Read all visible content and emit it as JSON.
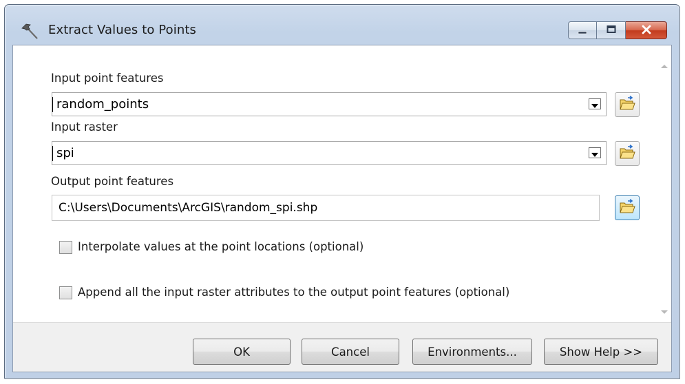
{
  "window": {
    "title": "Extract Values to Points",
    "title_icon": "hammer-icon",
    "minimize_icon": "minimize-icon",
    "maximize_icon": "maximize-icon",
    "close_icon": "close-icon"
  },
  "form": {
    "input_point_features": {
      "label": "Input point features",
      "value": "random_points",
      "browse_icon": "folder-open-icon"
    },
    "input_raster": {
      "label": "Input raster",
      "value": "spi",
      "browse_icon": "folder-open-icon"
    },
    "output_point_features": {
      "label": "Output point features",
      "value": "C:\\Users\\Documents\\ArcGIS\\random_spi.shp",
      "browse_icon": "folder-open-icon"
    },
    "interpolate": {
      "label": "Interpolate values at the point locations (optional)",
      "checked": false
    },
    "append_attributes": {
      "label": "Append all the input raster attributes to the output point features (optional)",
      "checked": false
    }
  },
  "buttons": {
    "ok": "OK",
    "cancel": "Cancel",
    "environments": "Environments...",
    "show_help": "Show Help >>"
  }
}
